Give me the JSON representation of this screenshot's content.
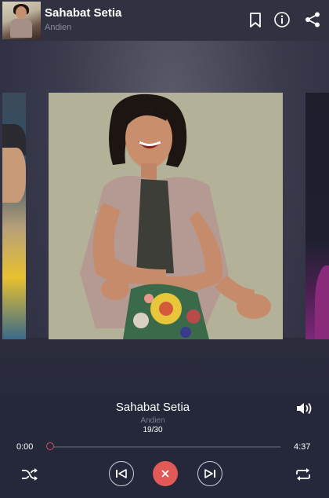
{
  "header": {
    "title": "Sahabat Setia",
    "artist": "Andien",
    "icons": [
      "bookmark-icon",
      "info-icon",
      "share-icon"
    ]
  },
  "now_playing": {
    "title": "Sahabat Setia",
    "artist": "Andien",
    "track_counter": "19/30",
    "elapsed": "0:00",
    "duration": "4:37",
    "progress": 0.0
  },
  "controls": [
    "shuffle-icon",
    "previous-icon",
    "stop-icon",
    "next-icon",
    "repeat-icon",
    "volume-icon"
  ],
  "colors": {
    "header_bg": "#303242",
    "panel_bg": "#25283a",
    "accent": "#e25a56"
  }
}
